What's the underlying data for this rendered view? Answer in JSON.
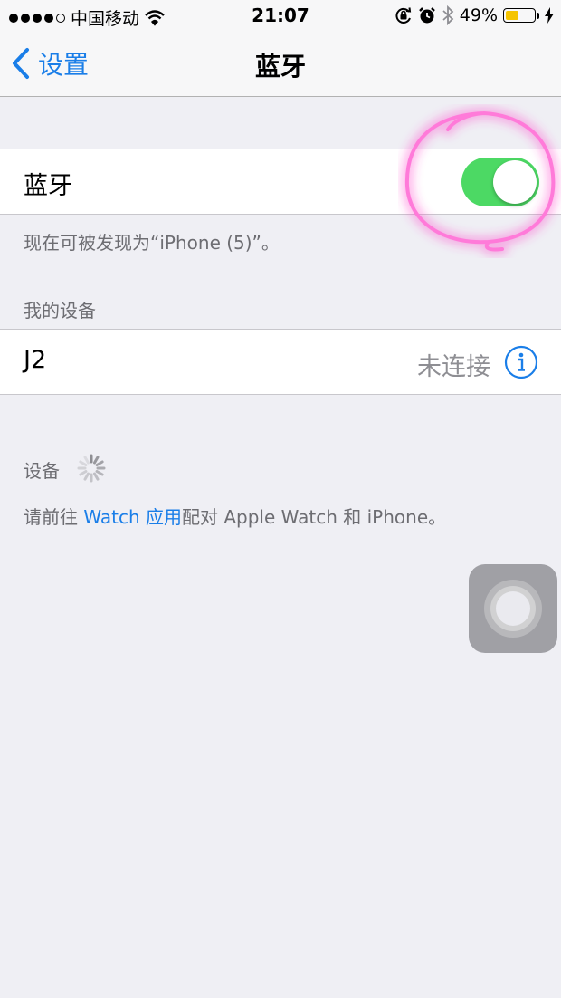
{
  "status_bar": {
    "carrier": "中国移动",
    "time": "21:07",
    "battery_percent": "49%",
    "battery_level": 0.49,
    "signal_bars_filled": 4,
    "signal_bars_total": 5,
    "icons": [
      "signal-dots",
      "wifi-icon",
      "orientation-lock-icon",
      "alarm-icon",
      "bluetooth-icon",
      "battery-icon",
      "charging-bolt-icon"
    ]
  },
  "nav": {
    "back_label": "设置",
    "title": "蓝牙"
  },
  "bluetooth": {
    "label": "蓝牙",
    "enabled": true,
    "discoverable_note": "现在可被发现为“iPhone (5)”。"
  },
  "my_devices": {
    "header": "我的设备",
    "items": [
      {
        "name": "J2",
        "status": "未连接"
      }
    ]
  },
  "devices": {
    "header": "设备"
  },
  "hint": {
    "prefix": "请前往 ",
    "link": "Watch 应用",
    "suffix": "配对 Apple Watch 和 iPhone。"
  },
  "colors": {
    "accent": "#1a7ee8",
    "toggle_on": "#4cd964",
    "background": "#efeff4",
    "annotation": "#ff3cc8",
    "battery": "#f5c400"
  }
}
